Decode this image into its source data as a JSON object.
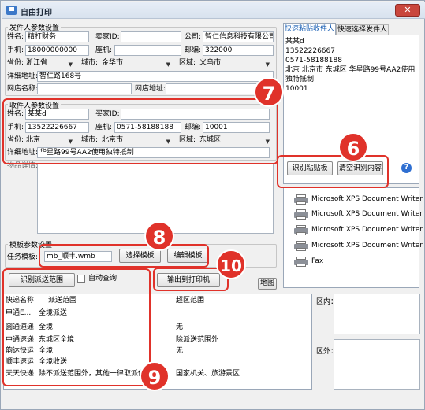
{
  "window": {
    "title": "自由打印",
    "close_label": "✕"
  },
  "sender": {
    "legend": "发件人参数设置",
    "name_label": "姓名:",
    "name_value": "精打财务",
    "seller_id_label": "卖家ID:",
    "seller_id_value": "",
    "company_label": "公司:",
    "company_value": "智仁信息科技有限公司",
    "mobile_label": "手机:",
    "mobile_value": "18000000000",
    "landline_label": "座机:",
    "landline_value": "",
    "postcode_label": "邮编:",
    "postcode_value": "322000",
    "province_label": "省份:",
    "province_value": "浙江省",
    "city_label": "城市:",
    "city_value": "金华市",
    "district_label": "区域:",
    "district_value": "义乌市",
    "address_label": "详细地址:",
    "address_value": "智仁路168号",
    "shop_name_label": "网店名称:",
    "shop_name_value": "",
    "shop_url_label": "网店地址:",
    "shop_url_value": ""
  },
  "receiver": {
    "legend": "收件人参数设置",
    "name_label": "姓名:",
    "name_value": "某某d",
    "buyer_id_label": "买家ID:",
    "buyer_id_value": "",
    "mobile_label": "手机:",
    "mobile_value": "13522226667",
    "landline_label": "座机:",
    "landline_value": "0571-58188188",
    "postcode_label": "邮编:",
    "postcode_value": "10001",
    "province_label": "省份:",
    "province_value": "北京",
    "city_label": "城市:",
    "city_value": "北京市",
    "district_label": "区域:",
    "district_value": "东城区",
    "address_label": "详细地址:",
    "address_value": "华星路99号AA2使用独特抵制"
  },
  "goods": {
    "label": "物品详情:"
  },
  "right_tabs": {
    "tab_paste_receiver": "快速粘贴收件人",
    "tab_select_sender": "快速选择发件人",
    "paste_text_lines": [
      "某某d",
      "13522226667",
      "0571-58188188",
      "北京 北京市 东城区 华星路99号AA2使用",
      "独特抵制",
      "10001"
    ],
    "recognize_clipboard_button": "识别粘贴板",
    "clear_recognize_button": "清空识别内容",
    "help_icon": "?"
  },
  "printers": {
    "items": [
      "Microsoft XPS Document Writer P",
      "Microsoft XPS Document Writer P",
      "Microsoft XPS Document Writer P",
      "Microsoft XPS Document Writer",
      "Fax"
    ]
  },
  "template": {
    "legend": "模板参数设置",
    "task_template_label": "任务模板:",
    "task_template_value": "mb_顺丰.wmb",
    "select_template_button": "选择模板",
    "edit_template_button": "编辑模板"
  },
  "actions": {
    "identify_range_button": "识别派送范围",
    "auto_query_label": "自动查询",
    "output_printer_button": "输出到打印机",
    "map_button": "地图"
  },
  "express_table": {
    "headers": [
      "快递名称",
      "派送范围",
      "超区范围"
    ],
    "rows": [
      [
        "申通E...",
        "全境派送",
        ""
      ],
      [
        "圆通速递",
        "全境",
        "无"
      ],
      [
        "中通速递",
        "东城区全境",
        "除派送范围外"
      ],
      [
        "韵达快运",
        "全境",
        "无"
      ],
      [
        "顺丰速运",
        "全境收送",
        ""
      ],
      [
        "天天快递",
        "除不派送范围外，其他一律取派件",
        "国家机关、旅游景区"
      ]
    ]
  },
  "area_panel": {
    "inside_label": "区内：",
    "outside_label": "区外："
  },
  "annotations": {
    "badge_6": "6",
    "badge_7": "7",
    "badge_8": "8",
    "badge_9": "9",
    "badge_10": "10"
  },
  "colors": {
    "annotation": "#e0322a",
    "tab_active": "#1a5fb4"
  }
}
